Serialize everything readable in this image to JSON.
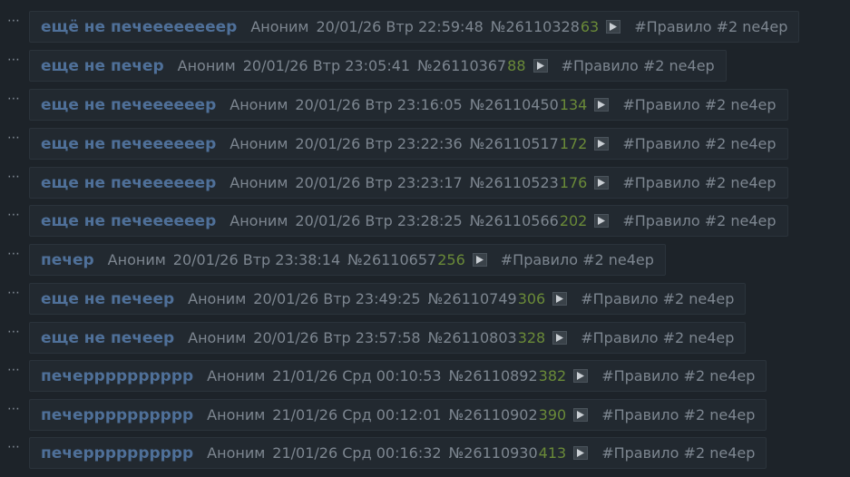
{
  "colors": {
    "background": "#1d2329",
    "post_background": "#222930",
    "subject": "#4f7099",
    "meta": "#7d8690",
    "reply_count": "#6a8a38"
  },
  "posts": [
    {
      "subject": "ещё не печеееееееер",
      "author": "Аноним",
      "date": "20/01/26 Втр 22:59:48",
      "number": "№26110328",
      "count": "63",
      "tag": "#Правило #2 ne4ep"
    },
    {
      "subject": "еще не печер",
      "author": "Аноним",
      "date": "20/01/26 Втр 23:05:41",
      "number": "№26110367",
      "count": "88",
      "tag": "#Правило #2 ne4ep"
    },
    {
      "subject": "еще не печеееееер",
      "author": "Аноним",
      "date": "20/01/26 Втр 23:16:05",
      "number": "№26110450",
      "count": "134",
      "tag": "#Правило #2 ne4ep"
    },
    {
      "subject": "еще не печеееееер",
      "author": "Аноним",
      "date": "20/01/26 Втр 23:22:36",
      "number": "№26110517",
      "count": "172",
      "tag": "#Правило #2 ne4ep"
    },
    {
      "subject": "еще не печеееееер",
      "author": "Аноним",
      "date": "20/01/26 Втр 23:23:17",
      "number": "№26110523",
      "count": "176",
      "tag": "#Правило #2 ne4ep"
    },
    {
      "subject": "еще не печеееееер",
      "author": "Аноним",
      "date": "20/01/26 Втр 23:28:25",
      "number": "№26110566",
      "count": "202",
      "tag": "#Правило #2 ne4ep"
    },
    {
      "subject": "печер",
      "author": "Аноним",
      "date": "20/01/26 Втр 23:38:14",
      "number": "№26110657",
      "count": "256",
      "tag": "#Правило #2 ne4ep"
    },
    {
      "subject": "еще не печеер",
      "author": "Аноним",
      "date": "20/01/26 Втр 23:49:25",
      "number": "№26110749",
      "count": "306",
      "tag": "#Правило #2 ne4ep"
    },
    {
      "subject": "еще не печеер",
      "author": "Аноним",
      "date": "20/01/26 Втр 23:57:58",
      "number": "№26110803",
      "count": "328",
      "tag": "#Правило #2 ne4ep"
    },
    {
      "subject": "печерррррррррр",
      "author": "Аноним",
      "date": "21/01/26 Срд 00:10:53",
      "number": "№26110892",
      "count": "382",
      "tag": "#Правило #2 ne4ep"
    },
    {
      "subject": "печерррррррррр",
      "author": "Аноним",
      "date": "21/01/26 Срд 00:12:01",
      "number": "№26110902",
      "count": "390",
      "tag": "#Правило #2 ne4ep"
    },
    {
      "subject": "печерррррррррр",
      "author": "Аноним",
      "date": "21/01/26 Срд 00:16:32",
      "number": "№26110930",
      "count": "413",
      "tag": "#Правило #2 ne4ep"
    }
  ]
}
